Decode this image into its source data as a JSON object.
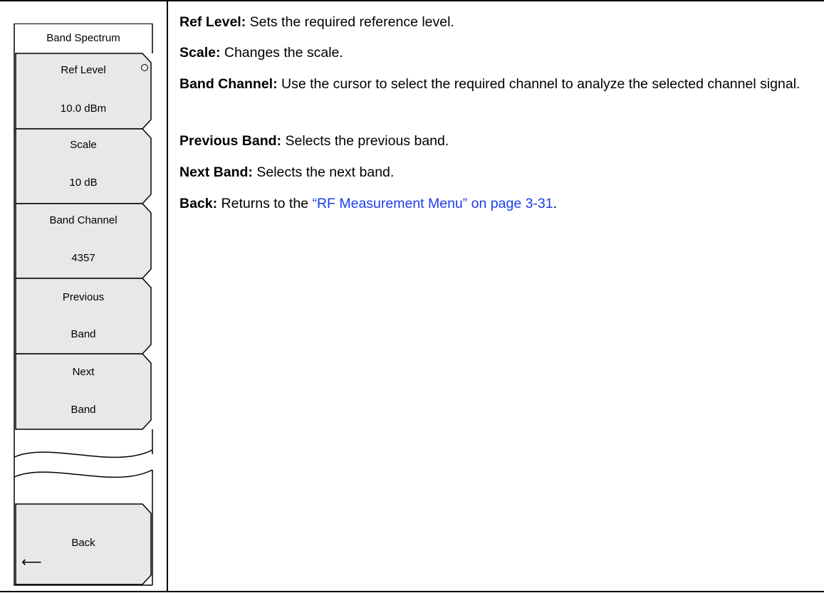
{
  "menu": {
    "title": "Band Spectrum",
    "keys": [
      {
        "line1": "Ref Level",
        "line2": "10.0 dBm",
        "has_radio": true
      },
      {
        "line1": "Scale",
        "line2": "10 dB"
      },
      {
        "line1": "Band Channel",
        "line2": "4357"
      },
      {
        "line1": "Previous",
        "line2": "Band"
      },
      {
        "line1": "Next",
        "line2": "Band"
      }
    ],
    "back": {
      "label": "Back",
      "icon": "left-arrow-icon",
      "glyph": "⟵"
    }
  },
  "descriptions": [
    {
      "term": "Ref Level:",
      "text": " Sets the required reference level."
    },
    {
      "term": "Scale:",
      "text": " Changes the scale."
    },
    {
      "term": "Band Channel:",
      "text": " Use the cursor to select the required channel to analyze the selected channel signal."
    },
    {
      "term": "Previous Band:",
      "text": " Selects the previous band."
    },
    {
      "term": "Next Band:",
      "text": " Selects the next band."
    },
    {
      "term": "Back:",
      "text": " Returns to the ",
      "link": "“RF Measurement Menu” on page 3-31",
      "after": "."
    }
  ],
  "colors": {
    "link": "#1a3ee8",
    "key_fill": "#e8e8e8"
  }
}
